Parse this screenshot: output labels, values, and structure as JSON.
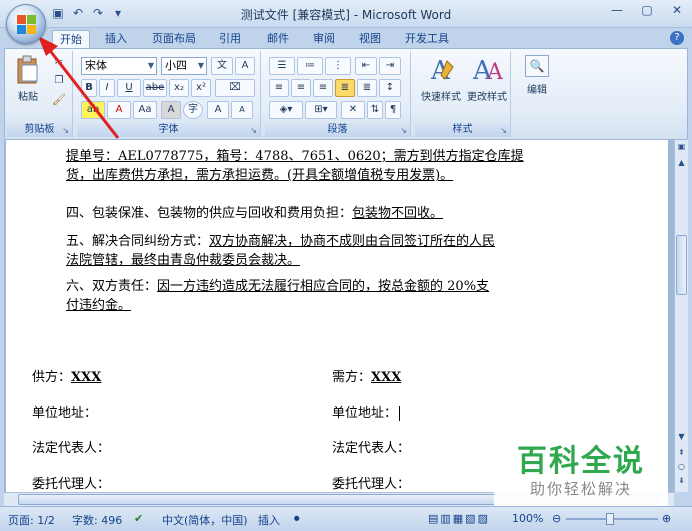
{
  "window": {
    "title": "测试文件 [兼容模式] - Microsoft Word",
    "qat": [
      "save-icon",
      "undo-icon",
      "redo-icon",
      "customize-icon"
    ]
  },
  "tabs": [
    "开始",
    "插入",
    "页面布局",
    "引用",
    "邮件",
    "审阅",
    "视图",
    "开发工具"
  ],
  "ribbon": {
    "clipboard": {
      "label": "剪贴板",
      "paste": "粘贴"
    },
    "font": {
      "label": "字体",
      "name": "宋体",
      "size": "小四",
      "bold": "B",
      "italic": "I",
      "underline": "U",
      "strike": "abe",
      "sub": "x₂",
      "sup": "x²",
      "clear": "Aa",
      "bigger": "A",
      "smaller": "A",
      "phonetic": "文",
      "char_border": "A",
      "enclose": "字",
      "char_shade": "A"
    },
    "paragraph": {
      "label": "段落"
    },
    "styles": {
      "label": "样式",
      "quick": "快速样式",
      "change": "更改样式"
    },
    "editing": {
      "label": "编辑",
      "edit": "编辑"
    }
  },
  "document": {
    "para1_line1": "提单号：AEL0778775，箱号：4788、7651、0620；需方到供方指定仓库提",
    "para1_line2": "货，出库费供方承担，需方承担运费。(开具全额增值税专用发票)。",
    "para2_prefix": "四、包装保准、包装物的供应与回收和费用负担：",
    "para2_value": "包装物不回收。",
    "para3_prefix": "五、解决合同纠纷方式：",
    "para3_value_line1": "双方协商解决，协商不成则由合同签订所在的人民",
    "para3_value_line2": "法院管辖，最终由青岛仲裁委员会裁决。",
    "para4_prefix": "六、双方责任：",
    "para4_value_line1": "因一方违约造成无法履行相应合同的，按总金额的 20%支",
    "para4_value_line2": "付违约金。",
    "left": {
      "supplier_label": "供方：",
      "supplier_value": "XXX",
      "address": "单位地址：",
      "legal_rep": "法定代表人：",
      "agent": "委托代理人："
    },
    "right": {
      "buyer_label": "需方：",
      "buyer_value": "XXX",
      "address": "单位地址：",
      "legal_rep": "法定代表人：",
      "agent": "委托代理人："
    }
  },
  "watermark": {
    "title": "百科全说",
    "subtitle": "助你轻松解决"
  },
  "status": {
    "page": "页面: 1/2",
    "words": "字数: 496",
    "language": "中文(简体，中国)",
    "mode": "插入",
    "zoom": "100%"
  },
  "colors": {
    "accent": "#e02020",
    "watermark": "#2fa84f"
  }
}
